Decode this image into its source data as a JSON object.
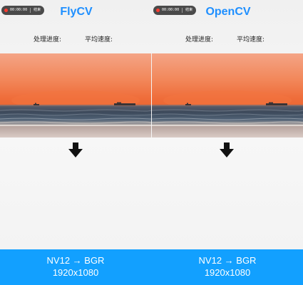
{
  "panels": [
    {
      "title": "FlyCV",
      "recording": {
        "time": "00:00:00",
        "end_label": "结束"
      },
      "stats": {
        "progress_label": "处理进度:",
        "speed_label": "平均速度:"
      },
      "image_icon": "sunset-ocean-photo",
      "arrow_icon": "arrow-down-icon"
    },
    {
      "title": "OpenCV",
      "recording": {
        "time": "00:00:00",
        "end_label": "结束"
      },
      "stats": {
        "progress_label": "处理进度:",
        "speed_label": "平均速度:"
      },
      "image_icon": "sunset-ocean-photo",
      "arrow_icon": "arrow-down-icon"
    }
  ],
  "footer": [
    {
      "conversion": "NV12 → BGR",
      "resolution": "1920x1080"
    },
    {
      "conversion": "NV12 → BGR",
      "resolution": "1920x1080"
    }
  ],
  "colors": {
    "title": "#1e8fff",
    "footer": "#12a0ff",
    "sky_top": "#f2a07f",
    "sky_horizon": "#f06f3b",
    "sea": "#3d4b5a",
    "recording_dot": "#ff3b30"
  }
}
